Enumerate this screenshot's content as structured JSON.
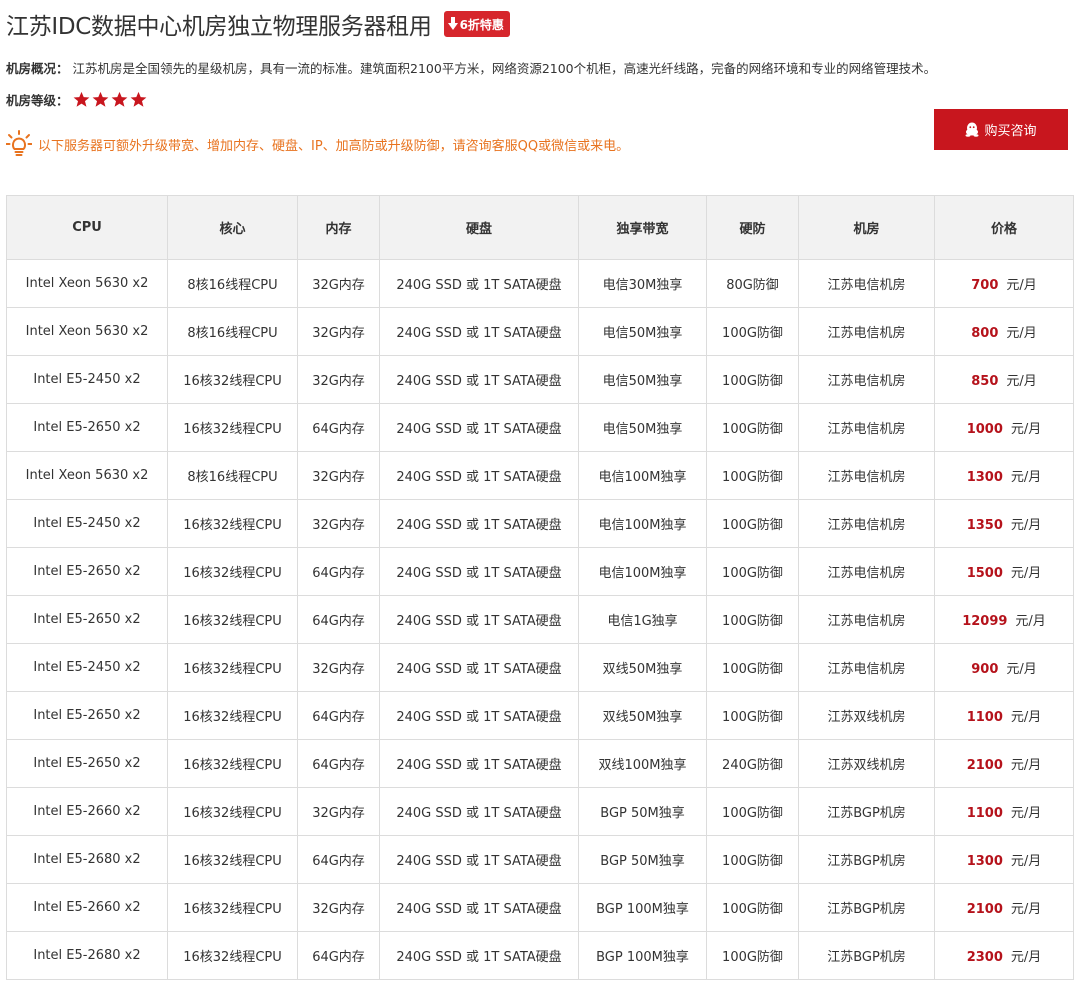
{
  "page": {
    "title": "江苏IDC数据中心机房独立物理服务器租用",
    "promo_badge": "6折特惠",
    "overview_label": "机房概况：",
    "overview_text": "江苏机房是全国领先的星级机房，具有一流的标准。建筑面积2100平方米，网络资源2100个机柜，高速光纤线路，完备的网络环境和专业的网络管理技术。",
    "level_label": "机房等级：",
    "star_rating": 4,
    "notice": "以下服务器可额外升级带宽、增加内存、硬盘、IP、加高防或升级防御，请咨询客服QQ或微信或来电。",
    "consult_button": "购买咨询"
  },
  "colors": {
    "accent": "#c8161e",
    "price": "#b5121b",
    "notice": "#e8731f",
    "star": "#c8161e"
  },
  "icons": {
    "promo": "arrow-down-icon",
    "star": "star-icon",
    "notice": "lightbulb-icon",
    "consult": "qq-penguin-icon"
  },
  "table": {
    "headers": [
      "CPU",
      "核心",
      "内存",
      "硬盘",
      "独享带宽",
      "硬防",
      "机房",
      "价格"
    ],
    "price_unit": "元/月",
    "rows": [
      {
        "cpu": "Intel Xeon 5630 x2",
        "cores": "8核16线程CPU",
        "mem": "32G内存",
        "disk": "240G SSD 或 1T SATA硬盘",
        "bw": "电信30M独享",
        "ddos": "80G防御",
        "room": "江苏电信机房",
        "price": "700"
      },
      {
        "cpu": "Intel Xeon 5630 x2",
        "cores": "8核16线程CPU",
        "mem": "32G内存",
        "disk": "240G SSD 或 1T SATA硬盘",
        "bw": "电信50M独享",
        "ddos": "100G防御",
        "room": "江苏电信机房",
        "price": "800"
      },
      {
        "cpu": "Intel E5-2450 x2",
        "cores": "16核32线程CPU",
        "mem": "32G内存",
        "disk": "240G SSD 或 1T SATA硬盘",
        "bw": "电信50M独享",
        "ddos": "100G防御",
        "room": "江苏电信机房",
        "price": "850"
      },
      {
        "cpu": "Intel E5-2650 x2",
        "cores": "16核32线程CPU",
        "mem": "64G内存",
        "disk": "240G SSD 或 1T SATA硬盘",
        "bw": "电信50M独享",
        "ddos": "100G防御",
        "room": "江苏电信机房",
        "price": "1000"
      },
      {
        "cpu": "Intel Xeon 5630 x2",
        "cores": "8核16线程CPU",
        "mem": "32G内存",
        "disk": "240G SSD 或 1T SATA硬盘",
        "bw": "电信100M独享",
        "ddos": "100G防御",
        "room": "江苏电信机房",
        "price": "1300"
      },
      {
        "cpu": "Intel E5-2450 x2",
        "cores": "16核32线程CPU",
        "mem": "32G内存",
        "disk": "240G SSD 或 1T SATA硬盘",
        "bw": "电信100M独享",
        "ddos": "100G防御",
        "room": "江苏电信机房",
        "price": "1350"
      },
      {
        "cpu": "Intel E5-2650 x2",
        "cores": "16核32线程CPU",
        "mem": "64G内存",
        "disk": "240G SSD 或 1T SATA硬盘",
        "bw": "电信100M独享",
        "ddos": "100G防御",
        "room": "江苏电信机房",
        "price": "1500"
      },
      {
        "cpu": "Intel E5-2650 x2",
        "cores": "16核32线程CPU",
        "mem": "64G内存",
        "disk": "240G SSD 或 1T SATA硬盘",
        "bw": "电信1G独享",
        "ddos": "100G防御",
        "room": "江苏电信机房",
        "price": "12099"
      },
      {
        "cpu": "Intel E5-2450 x2",
        "cores": "16核32线程CPU",
        "mem": "32G内存",
        "disk": "240G SSD 或 1T SATA硬盘",
        "bw": "双线50M独享",
        "ddos": "100G防御",
        "room": "江苏电信机房",
        "price": "900"
      },
      {
        "cpu": "Intel E5-2650 x2",
        "cores": "16核32线程CPU",
        "mem": "64G内存",
        "disk": "240G SSD 或 1T SATA硬盘",
        "bw": "双线50M独享",
        "ddos": "100G防御",
        "room": "江苏双线机房",
        "price": "1100"
      },
      {
        "cpu": "Intel E5-2650 x2",
        "cores": "16核32线程CPU",
        "mem": "64G内存",
        "disk": "240G SSD 或 1T SATA硬盘",
        "bw": "双线100M独享",
        "ddos": "240G防御",
        "room": "江苏双线机房",
        "price": "2100"
      },
      {
        "cpu": "Intel E5-2660 x2",
        "cores": "16核32线程CPU",
        "mem": "32G内存",
        "disk": "240G SSD 或 1T SATA硬盘",
        "bw": "BGP 50M独享",
        "ddos": "100G防御",
        "room": "江苏BGP机房",
        "price": "1100"
      },
      {
        "cpu": "Intel E5-2680 x2",
        "cores": "16核32线程CPU",
        "mem": "64G内存",
        "disk": "240G SSD 或 1T SATA硬盘",
        "bw": "BGP 50M独享",
        "ddos": "100G防御",
        "room": "江苏BGP机房",
        "price": "1300"
      },
      {
        "cpu": "Intel E5-2660 x2",
        "cores": "16核32线程CPU",
        "mem": "32G内存",
        "disk": "240G SSD 或 1T SATA硬盘",
        "bw": "BGP 100M独享",
        "ddos": "100G防御",
        "room": "江苏BGP机房",
        "price": "2100"
      },
      {
        "cpu": "Intel E5-2680 x2",
        "cores": "16核32线程CPU",
        "mem": "64G内存",
        "disk": "240G SSD 或 1T SATA硬盘",
        "bw": "BGP 100M独享",
        "ddos": "100G防御",
        "room": "江苏BGP机房",
        "price": "2300"
      }
    ]
  }
}
